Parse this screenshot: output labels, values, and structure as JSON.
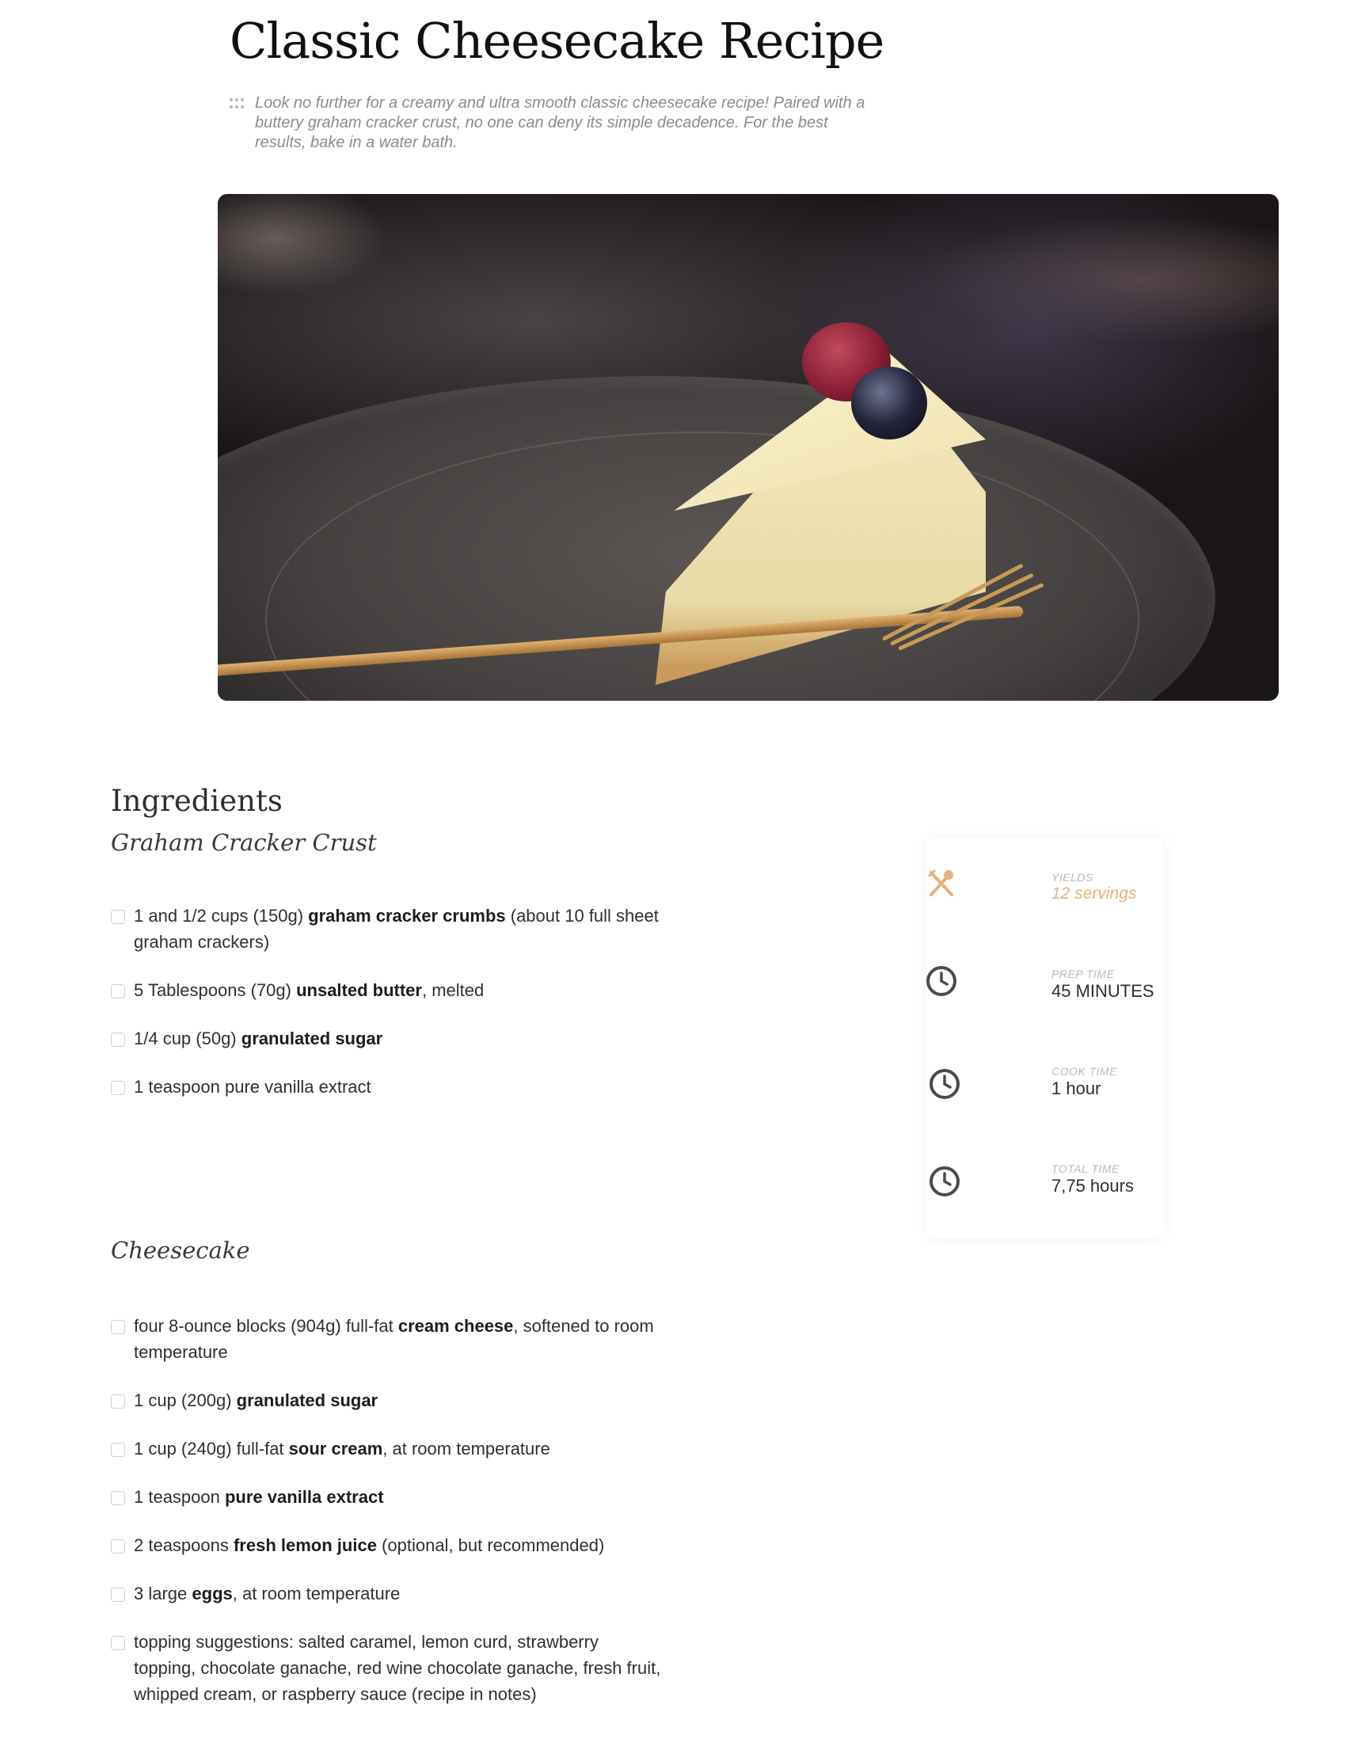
{
  "title": "Classic Cheesecake Recipe",
  "intro": "Look no further for a creamy and ultra smooth classic cheesecake recipe! Paired with a buttery graham cracker crust, no one can deny its simple decadence. For the best results, bake in a water bath.",
  "hero_image": {
    "alt": "Slice of cheesecake with raspberry and blueberry on dark plate with gold fork"
  },
  "ingredients_heading": "Ingredients",
  "groups": [
    {
      "name": "Graham Cracker Crust",
      "items": [
        {
          "pre": "1 and 1/2 cups (150g) ",
          "bold": "graham cracker crumbs",
          "post": " (about 10 full sheet graham crackers)"
        },
        {
          "pre": "5 Tablespoons (70g) ",
          "bold": "unsalted butter",
          "post": ", melted"
        },
        {
          "pre": "1/4 cup (50g) ",
          "bold": "granulated sugar",
          "post": ""
        },
        {
          "pre": "1 teaspoon pure vanilla extract",
          "bold": "",
          "post": ""
        }
      ]
    },
    {
      "name": "Cheesecake",
      "items": [
        {
          "pre": "four 8-ounce blocks (904g) full-fat ",
          "bold": "cream cheese",
          "post": ", softened to room temperature"
        },
        {
          "pre": "1 cup (200g) ",
          "bold": "granulated sugar",
          "post": ""
        },
        {
          "pre": "1 cup (240g) full-fat ",
          "bold": "sour cream",
          "post": ", at room temperature"
        },
        {
          "pre": "1 teaspoon ",
          "bold": "pure vanilla extract",
          "post": ""
        },
        {
          "pre": "2 teaspoons ",
          "bold": "fresh lemon juice",
          "post": " (optional, but recommended)"
        },
        {
          "pre": "3 large ",
          "bold": "eggs",
          "post": ", at room temperature"
        },
        {
          "pre": "topping suggestions: salted caramel, lemon curd, strawberry topping, chocolate ganache, red wine chocolate ganache, fresh fruit, whipped cream, or raspberry sauce (recipe in notes)",
          "bold": "",
          "post": ""
        }
      ]
    }
  ],
  "meta": [
    {
      "label": "YIELDS",
      "value": "12 servings",
      "icon": "utensils-icon",
      "accent": true
    },
    {
      "label": "PREP TIME",
      "value": "45 MINUTES",
      "icon": "clock-icon",
      "accent": false
    },
    {
      "label": "COOK TIME",
      "value": "1 hour",
      "icon": "clock-icon",
      "accent": false
    },
    {
      "label": "TOTAL TIME",
      "value": "7,75 hours",
      "icon": "clock-icon",
      "accent": false
    }
  ],
  "colors": {
    "accent": "#e3b27e",
    "icon_dark": "#4a4a4a",
    "checkbox_border": "#d0d0d0"
  }
}
